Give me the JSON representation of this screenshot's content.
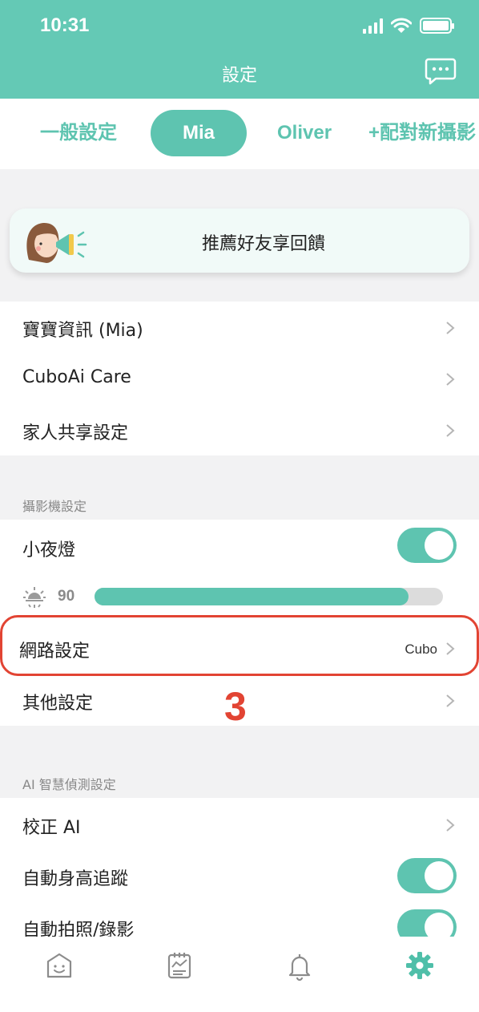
{
  "status_bar": {
    "time": "10:31"
  },
  "header": {
    "title": "設定"
  },
  "tabs": [
    {
      "label": "一般設定",
      "active": false
    },
    {
      "label": "Mia",
      "active": true
    },
    {
      "label": "Oliver",
      "active": false
    },
    {
      "label": "+配對新攝影",
      "active": false
    }
  ],
  "promo": {
    "text": "推薦好友享回饋"
  },
  "baby_section": {
    "items": [
      {
        "label": "寶寶資訊 (Mia)"
      },
      {
        "label": "CuboAi Care"
      },
      {
        "label": "家人共享設定"
      }
    ]
  },
  "camera_section": {
    "title": "攝影機設定",
    "night_light": {
      "label": "小夜燈",
      "on": true
    },
    "brightness": {
      "value": "90",
      "level_percent": 90
    },
    "network": {
      "label": "網路設定",
      "value": "Cubo"
    },
    "other": {
      "label": "其他設定"
    }
  },
  "annotation": {
    "step_number": "3"
  },
  "ai_section": {
    "title": "AI 智慧偵測設定",
    "calibrate": {
      "label": "校正 AI"
    },
    "auto_height": {
      "label": "自動身高追蹤",
      "on": true
    },
    "auto_capture": {
      "label": "自動拍照/錄影",
      "on": true
    }
  },
  "tab_bar": {
    "items": [
      "home-icon",
      "report-icon",
      "bell-icon",
      "gear-icon"
    ],
    "active": "gear-icon"
  },
  "colors": {
    "brand": "#64c9b5",
    "accent": "#5ec4b0",
    "annotation": "#e24433"
  }
}
